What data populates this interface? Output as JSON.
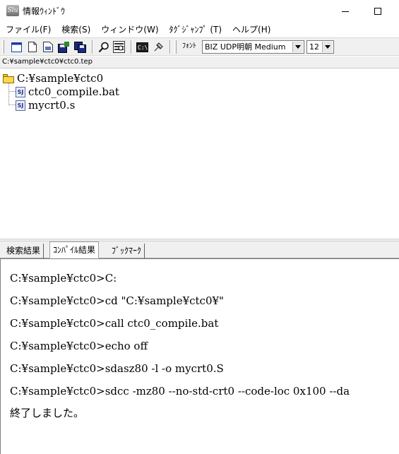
{
  "window": {
    "icon_text": "Slu",
    "title": "情報ｳｨﾝﾄﾞｳ",
    "minimize_symbol": "—",
    "maximize_symbol": "☐"
  },
  "menu": {
    "items": [
      {
        "label": "ファイル(F)"
      },
      {
        "label": "検索(S)"
      },
      {
        "label": "ウィンドウ(W)"
      },
      {
        "label": "ﾀｸﾞｼﾞｬﾝﾌﾟ (T)"
      },
      {
        "label": "ヘルプ(H)"
      }
    ]
  },
  "toolbar": {
    "buttons": [
      {
        "icon": "window-icon"
      },
      {
        "icon": "new-file-icon"
      },
      {
        "icon": "open-file-icon"
      },
      {
        "icon": "save-icon"
      },
      {
        "icon": "save-all-icon"
      },
      {
        "icon": "search-icon"
      },
      {
        "icon": "grep-icon"
      },
      {
        "icon": "command-prompt-icon"
      },
      {
        "icon": "tag-jump-icon"
      }
    ],
    "font_label": "ﾌｫﾝﾄ",
    "font_name": "BIZ UDP明朝 Medium",
    "font_size": "12"
  },
  "path": "C:¥sample¥ctc0¥ctc0.tep",
  "tree": {
    "root": "C:¥sample¥ctc0",
    "children": [
      {
        "label": "ctc0_compile.bat",
        "badge": "SJ"
      },
      {
        "label": "mycrt0.s",
        "badge": "SJ"
      }
    ]
  },
  "tabs": [
    {
      "label": "検索結果"
    },
    {
      "label": "ｺﾝﾊﾟｲﾙ結果"
    },
    {
      "label": "ﾌﾞｯｸﾏｰｸ"
    }
  ],
  "output": {
    "lines": [
      "C:¥sample¥ctc0>C:",
      "C:¥sample¥ctc0>cd \"C:¥sample¥ctc0¥\"",
      "C:¥sample¥ctc0>call ctc0_compile.bat",
      "C:¥sample¥ctc0>echo off",
      "C:¥sample¥ctc0>sdasz80 -l -o mycrt0.S",
      "C:¥sample¥ctc0>sdcc -mz80 --no-std-crt0 --code-loc 0x100 --da",
      "終了しました。"
    ]
  },
  "colors": {
    "folder": "#fbd84a",
    "toolbar_bg": "#f0f0f0",
    "file_badge": "#20308a"
  }
}
